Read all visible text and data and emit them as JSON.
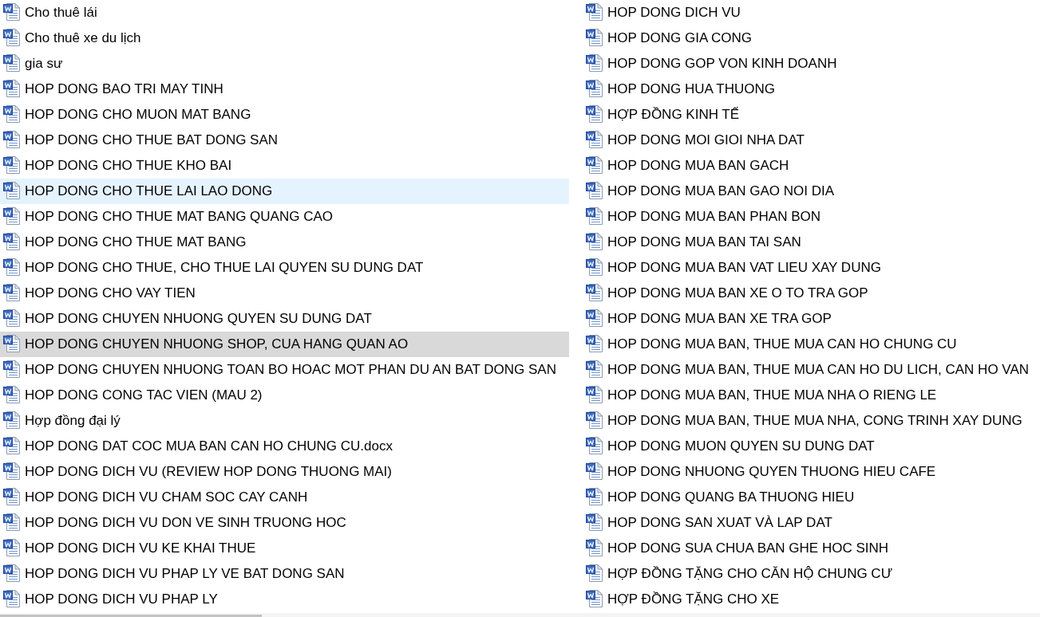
{
  "files": [
    {
      "name": "Cho thuê lái",
      "selected": false,
      "hovered": false
    },
    {
      "name": "Cho thuê xe du lịch",
      "selected": false,
      "hovered": false
    },
    {
      "name": "gia sư",
      "selected": false,
      "hovered": false
    },
    {
      "name": "HOP DONG BAO TRI MAY TINH",
      "selected": false,
      "hovered": false
    },
    {
      "name": "HOP DONG CHO MUON MAT BANG",
      "selected": false,
      "hovered": false
    },
    {
      "name": "HOP DONG CHO THUE BAT DONG SAN",
      "selected": false,
      "hovered": false
    },
    {
      "name": "HOP DONG CHO THUE KHO BAI",
      "selected": false,
      "hovered": false
    },
    {
      "name": "HOP DONG CHO THUE LAI LAO DONG",
      "selected": false,
      "hovered": true
    },
    {
      "name": "HOP DONG CHO THUE MAT BANG QUANG CAO",
      "selected": false,
      "hovered": false
    },
    {
      "name": "HOP DONG CHO THUE MAT BANG",
      "selected": false,
      "hovered": false
    },
    {
      "name": "HOP DONG CHO THUE, CHO THUE LAI QUYEN SU DUNG DAT",
      "selected": false,
      "hovered": false
    },
    {
      "name": "HOP DONG CHO VAY TIEN",
      "selected": false,
      "hovered": false
    },
    {
      "name": "HOP DONG CHUYEN NHUONG QUYEN SU DUNG DAT",
      "selected": false,
      "hovered": false
    },
    {
      "name": "HOP DONG CHUYEN NHUONG SHOP, CUA HANG QUAN AO",
      "selected": true,
      "hovered": false
    },
    {
      "name": "HOP DONG CHUYEN NHUONG TOAN BO HOAC MOT PHAN DU AN BAT DONG SAN",
      "selected": false,
      "hovered": false
    },
    {
      "name": "HOP DONG CONG TAC VIEN (MAU 2)",
      "selected": false,
      "hovered": false
    },
    {
      "name": "Hợp đồng đại lý",
      "selected": false,
      "hovered": false
    },
    {
      "name": "HOP DONG DAT COC MUA BAN CAN HO CHUNG CU.docx",
      "selected": false,
      "hovered": false
    },
    {
      "name": "HOP DONG DICH VU (REVIEW HOP DONG THUONG MAI)",
      "selected": false,
      "hovered": false
    },
    {
      "name": "HOP DONG DICH VU CHAM SOC CAY CANH",
      "selected": false,
      "hovered": false
    },
    {
      "name": "HOP DONG DICH VU DON VE SINH TRUONG HOC",
      "selected": false,
      "hovered": false
    },
    {
      "name": "HOP DONG DICH VU KE KHAI THUE",
      "selected": false,
      "hovered": false
    },
    {
      "name": "HOP DONG DICH VU PHAP LY VE BAT DONG SAN",
      "selected": false,
      "hovered": false
    },
    {
      "name": "HOP DONG DICH VU PHAP LY",
      "selected": false,
      "hovered": false
    },
    {
      "name": "HOP DONG DICH VU",
      "selected": false,
      "hovered": false
    },
    {
      "name": "HOP DONG GIA CONG",
      "selected": false,
      "hovered": false
    },
    {
      "name": "HOP DONG GOP VON KINH DOANH",
      "selected": false,
      "hovered": false
    },
    {
      "name": "HOP DONG HUA THUONG",
      "selected": false,
      "hovered": false
    },
    {
      "name": "HỢP ĐỒNG KINH TẾ",
      "selected": false,
      "hovered": false
    },
    {
      "name": "HOP DONG MOI GIOI NHA DAT",
      "selected": false,
      "hovered": false
    },
    {
      "name": "HOP DONG MUA BAN GACH",
      "selected": false,
      "hovered": false
    },
    {
      "name": "HOP DONG MUA BAN GAO NOI DIA",
      "selected": false,
      "hovered": false
    },
    {
      "name": "HOP DONG MUA BAN PHAN BON",
      "selected": false,
      "hovered": false
    },
    {
      "name": "HOP DONG MUA BAN TAI SAN",
      "selected": false,
      "hovered": false
    },
    {
      "name": "HOP DONG MUA BAN VAT LIEU XAY DUNG",
      "selected": false,
      "hovered": false
    },
    {
      "name": "HOP DONG MUA BAN XE O TO TRA GOP",
      "selected": false,
      "hovered": false
    },
    {
      "name": "HOP DONG MUA BAN XE TRA GOP",
      "selected": false,
      "hovered": false
    },
    {
      "name": "HOP DONG MUA BAN, THUE MUA CAN HO CHUNG CU",
      "selected": false,
      "hovered": false
    },
    {
      "name": "HOP DONG MUA BAN, THUE MUA CAN HO DU LICH, CAN HO VAN",
      "selected": false,
      "hovered": false
    },
    {
      "name": "HOP DONG MUA BAN, THUE MUA NHA O RIENG LE",
      "selected": false,
      "hovered": false
    },
    {
      "name": "HOP DONG MUA BAN, THUE MUA NHA, CONG TRINH XAY DUNG",
      "selected": false,
      "hovered": false
    },
    {
      "name": "HOP DONG MUON QUYEN SU DUNG DAT",
      "selected": false,
      "hovered": false
    },
    {
      "name": "HOP DONG NHUONG QUYEN THUONG HIEU CAFE",
      "selected": false,
      "hovered": false
    },
    {
      "name": "HOP DONG QUANG BA THUONG HIEU",
      "selected": false,
      "hovered": false
    },
    {
      "name": "HOP DONG SAN XUAT VÀ LAP DAT",
      "selected": false,
      "hovered": false
    },
    {
      "name": "HOP DONG SUA CHUA BAN GHE HOC SINH",
      "selected": false,
      "hovered": false
    },
    {
      "name": "HỢP ĐỒNG TẶNG CHO CĂN HỘ CHUNG CƯ",
      "selected": false,
      "hovered": false
    },
    {
      "name": "HỢP ĐỒNG TẶNG CHO XE",
      "selected": false,
      "hovered": false
    }
  ]
}
